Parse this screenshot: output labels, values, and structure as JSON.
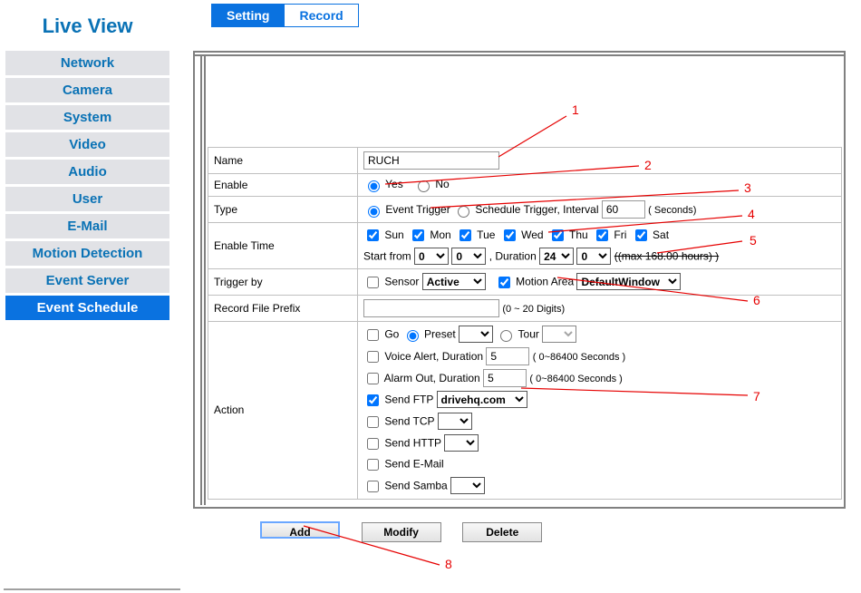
{
  "sidebar": {
    "title": "Live View",
    "items": [
      {
        "label": "Network"
      },
      {
        "label": "Camera"
      },
      {
        "label": "System"
      },
      {
        "label": "Video"
      },
      {
        "label": "Audio"
      },
      {
        "label": "User"
      },
      {
        "label": "E-Mail"
      },
      {
        "label": "Motion Detection"
      },
      {
        "label": "Event Server"
      },
      {
        "label": "Event Schedule"
      }
    ],
    "active_index": 9
  },
  "tabs": {
    "items": [
      {
        "label": "Setting"
      },
      {
        "label": "Record"
      }
    ],
    "active_index": 0
  },
  "form": {
    "name": {
      "label": "Name",
      "value": "RUCH"
    },
    "enable": {
      "label": "Enable",
      "yes": "Yes",
      "no": "No",
      "value": "yes"
    },
    "type": {
      "label": "Type",
      "event": "Event Trigger",
      "schedule_pre": "Schedule Trigger, Interval",
      "interval_value": "60",
      "seconds_suffix": "( Seconds)",
      "value": "event"
    },
    "enable_time": {
      "label": "Enable Time",
      "days": [
        "Sun",
        "Mon",
        "Tue",
        "Wed",
        "Thu",
        "Fri",
        "Sat"
      ],
      "start_from": "Start from",
      "h1": "0",
      "m1": "0",
      "duration": ", Duration",
      "h2": "24",
      "m2": "0",
      "max_note": "((max 168.00 hours) )"
    },
    "trigger": {
      "label": "Trigger by",
      "sensor_label": "Sensor",
      "sensor_value": "Active",
      "motion_label": "Motion Area",
      "motion_value": "DefaultWindow"
    },
    "prefix": {
      "label": "Record File Prefix",
      "value": "",
      "note": "(0 ~ 20 Digits)"
    },
    "action": {
      "label": "Action",
      "go": "Go",
      "preset": "Preset",
      "tour": "Tour",
      "voice": "Voice Alert, Duration",
      "voice_val": "5",
      "voice_suffix": "( 0~86400 Seconds )",
      "alarm": "Alarm Out, Duration",
      "alarm_val": "5",
      "alarm_suffix": "( 0~86400 Seconds )",
      "ftp": "Send FTP",
      "ftp_val": "drivehq.com",
      "tcp": "Send TCP",
      "http": "Send HTTP",
      "email": "Send E-Mail",
      "samba": "Send Samba"
    }
  },
  "buttons": {
    "add": "Add",
    "modify": "Modify",
    "delete": "Delete"
  },
  "annotations": [
    "1",
    "2",
    "3",
    "4",
    "5",
    "6",
    "7",
    "8"
  ]
}
